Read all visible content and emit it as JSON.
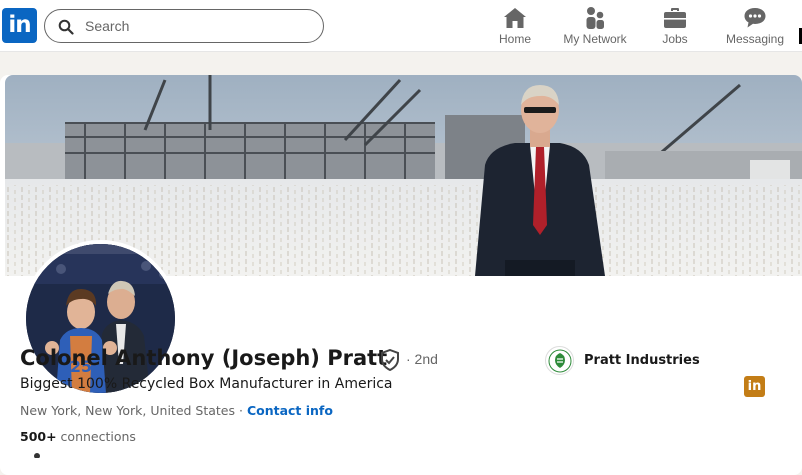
{
  "header": {
    "logo_text": "in",
    "search": {
      "placeholder": "Search"
    },
    "nav": [
      {
        "label": "Home",
        "icon": "home-icon"
      },
      {
        "label": "My Network",
        "icon": "people-icon"
      },
      {
        "label": "Jobs",
        "icon": "briefcase-icon"
      },
      {
        "label": "Messaging",
        "icon": "chat-icon"
      }
    ]
  },
  "profile": {
    "name": "Colonel Anthony (Joseph) Pratt",
    "degree": "· 2nd",
    "headline": "Biggest 100% Recycled Box Manufacturer in America",
    "location": "New York, New York, United States",
    "location_sep": " · ",
    "contact_label": "Contact info",
    "connections_count": "500+",
    "connections_label": " connections",
    "badge_text": "in",
    "company": {
      "name": "Pratt Industries"
    }
  },
  "colors": {
    "brand_blue": "#0a66c2",
    "badge_gold": "#c37d16",
    "company_green": "#2e8b3a"
  }
}
